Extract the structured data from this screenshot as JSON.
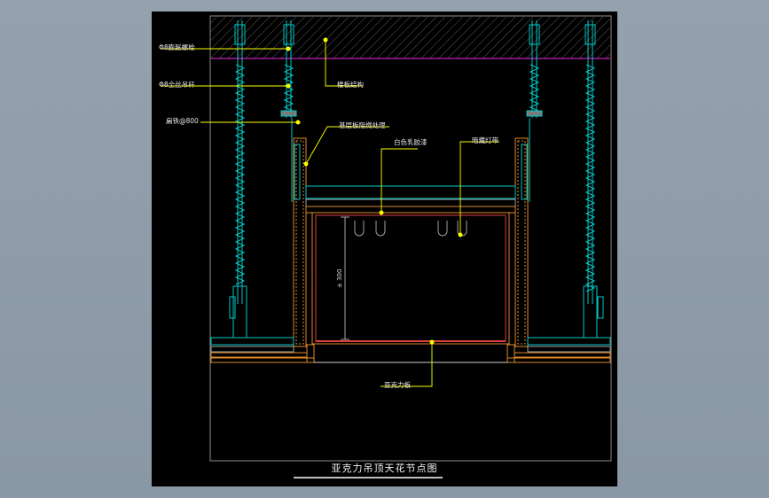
{
  "drawing": {
    "title": "亚克力吊顶天花节点图",
    "labels": {
      "expansion_bolt": "Φ8膨胀螺栓",
      "threaded_rod": "Φ8全丝吊杆",
      "keel_c38": "扁铁@800",
      "floor_slab": "楼板结构",
      "base_board": "基层板阻燃处理",
      "white_latex": "白色乳胶漆",
      "hidden_lamp": "暗藏灯带",
      "acrylic": "亚克力板",
      "dim_height": "± 300"
    }
  },
  "colors": {
    "slab_line": "#c020c0",
    "cyan": "#00c8c8",
    "orange": "#e08a2a",
    "yellow": "#ffff00",
    "red": "#e04040",
    "frame": "#a0a0a0"
  }
}
